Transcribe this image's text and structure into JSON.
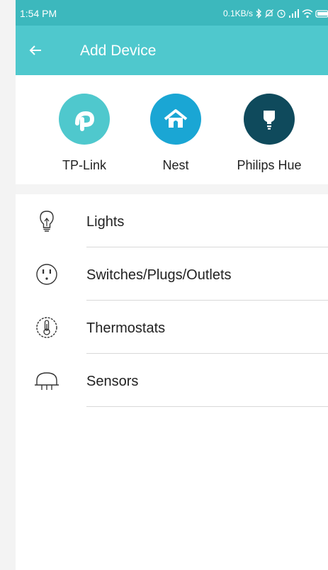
{
  "status_bar": {
    "time": "1:54 PM",
    "net_speed": "0.1KB/s",
    "background": "#3cb8bd"
  },
  "app_bar": {
    "title": "Add Device",
    "back_icon": "arrow-left-icon",
    "background": "#4fc8cd"
  },
  "brands": [
    {
      "label": "TP-Link",
      "icon": "tp-link-logo-icon",
      "color": "#4fc8cd"
    },
    {
      "label": "Nest",
      "icon": "nest-house-icon",
      "color": "#1aa6d4"
    },
    {
      "label": "Philips Hue",
      "icon": "hue-bulb-icon",
      "color": "#0f4a5c"
    }
  ],
  "categories": [
    {
      "label": "Lights",
      "icon": "lightbulb-icon"
    },
    {
      "label": "Switches/Plugs/Outlets",
      "icon": "outlet-icon"
    },
    {
      "label": "Thermostats",
      "icon": "thermostat-icon"
    },
    {
      "label": "Sensors",
      "icon": "sensor-icon"
    }
  ]
}
